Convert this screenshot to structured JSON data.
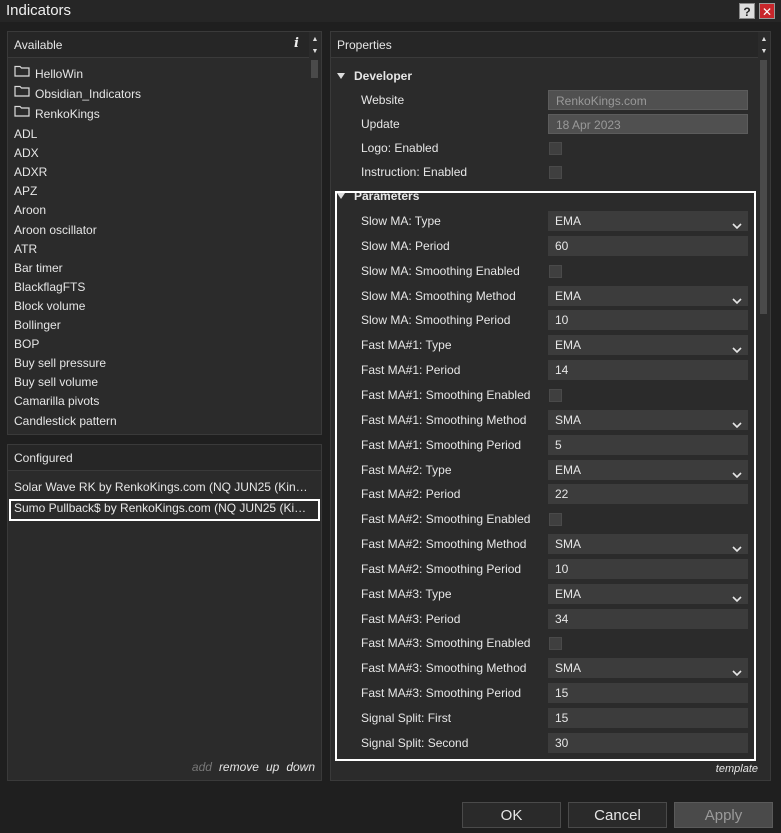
{
  "window": {
    "title": "Indicators",
    "help_label": "?",
    "close_label": "✕"
  },
  "available": {
    "header": "Available",
    "info_label": "i",
    "folders": [
      "HelloWin",
      "Obsidian_Indicators",
      "RenkoKings"
    ],
    "items": [
      "ADL",
      "ADX",
      "ADXR",
      "APZ",
      "Aroon",
      "Aroon oscillator",
      "ATR",
      "Bar timer",
      "BlackflagFTS",
      "Block volume",
      "Bollinger",
      "BOP",
      "Buy sell pressure",
      "Buy sell volume",
      "Camarilla pivots",
      "Candlestick pattern"
    ]
  },
  "configured": {
    "header": "Configured",
    "items": [
      "Solar Wave RK by RenkoKings.com (NQ JUN25 (Kin…",
      "Sumo Pullback$ by RenkoKings.com (NQ JUN25 (Ki…"
    ],
    "selected_index": 1,
    "actions": {
      "add": "add",
      "remove": "remove",
      "up": "up",
      "down": "down"
    }
  },
  "properties": {
    "header": "Properties",
    "developer": {
      "label": "Developer",
      "rows": [
        {
          "label": "Website",
          "type": "readonly",
          "value": "RenkoKings.com"
        },
        {
          "label": "Update",
          "type": "readonly",
          "value": "18 Apr 2023"
        },
        {
          "label": "Logo: Enabled",
          "type": "checkbox",
          "checked": false
        },
        {
          "label": "Instruction: Enabled",
          "type": "checkbox",
          "checked": false
        }
      ]
    },
    "parameters": {
      "label": "Parameters",
      "rows": [
        {
          "label": "Slow MA: Type",
          "type": "select",
          "value": "EMA"
        },
        {
          "label": "Slow MA: Period",
          "type": "text",
          "value": "60"
        },
        {
          "label": "Slow MA: Smoothing Enabled",
          "type": "checkbox",
          "checked": false
        },
        {
          "label": "Slow MA: Smoothing Method",
          "type": "select",
          "value": "EMA"
        },
        {
          "label": "Slow MA: Smoothing Period",
          "type": "text",
          "value": "10"
        },
        {
          "label": "Fast MA#1: Type",
          "type": "select",
          "value": "EMA"
        },
        {
          "label": "Fast MA#1: Period",
          "type": "text",
          "value": "14"
        },
        {
          "label": "Fast MA#1: Smoothing Enabled",
          "type": "checkbox",
          "checked": false
        },
        {
          "label": "Fast MA#1: Smoothing Method",
          "type": "select",
          "value": "SMA"
        },
        {
          "label": "Fast MA#1: Smoothing Period",
          "type": "text",
          "value": "5"
        },
        {
          "label": "Fast MA#2: Type",
          "type": "select",
          "value": "EMA"
        },
        {
          "label": "Fast MA#2: Period",
          "type": "text",
          "value": "22"
        },
        {
          "label": "Fast MA#2: Smoothing Enabled",
          "type": "checkbox",
          "checked": false
        },
        {
          "label": "Fast MA#2: Smoothing Method",
          "type": "select",
          "value": "SMA"
        },
        {
          "label": "Fast MA#2: Smoothing Period",
          "type": "text",
          "value": "10"
        },
        {
          "label": "Fast MA#3: Type",
          "type": "select",
          "value": "EMA"
        },
        {
          "label": "Fast MA#3: Period",
          "type": "text",
          "value": "34"
        },
        {
          "label": "Fast MA#3: Smoothing Enabled",
          "type": "checkbox",
          "checked": false
        },
        {
          "label": "Fast MA#3: Smoothing Method",
          "type": "select",
          "value": "SMA"
        },
        {
          "label": "Fast MA#3: Smoothing Period",
          "type": "text",
          "value": "15"
        },
        {
          "label": "Signal Split: First",
          "type": "text",
          "value": "15"
        },
        {
          "label": "Signal Split: Second",
          "type": "text",
          "value": "30"
        }
      ]
    },
    "template_label": "template"
  },
  "buttons": {
    "ok": "OK",
    "cancel": "Cancel",
    "apply": "Apply"
  }
}
